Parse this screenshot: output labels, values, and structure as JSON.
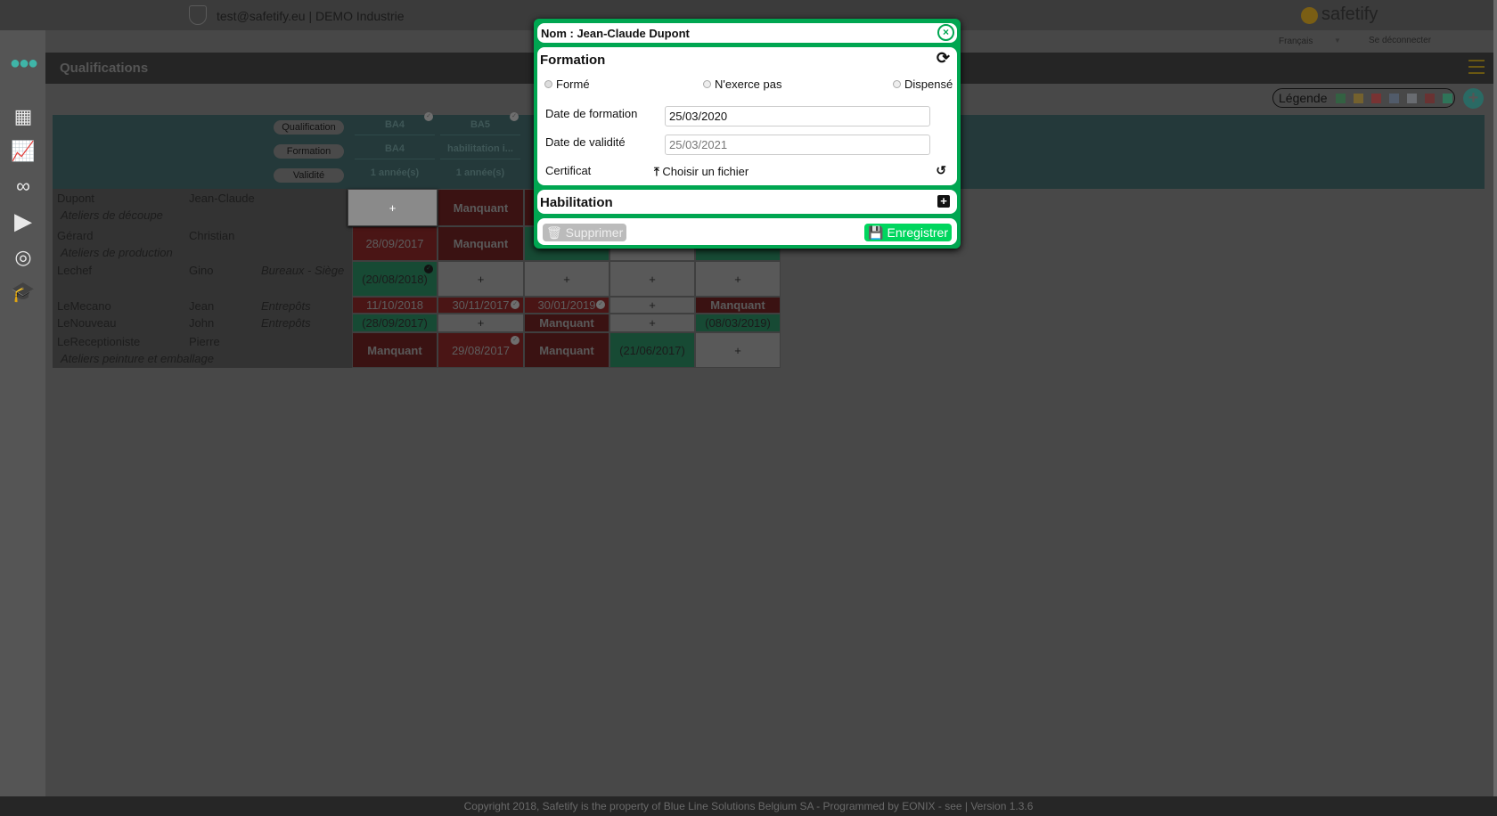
{
  "header": {
    "account": "test@safetify.eu | DEMO Industrie",
    "brand": "safetify",
    "language": "Français",
    "logout": "Se déconnecter"
  },
  "page": {
    "title": "Qualifications"
  },
  "sidebar": {
    "items": [
      "more-icon",
      "buildings-icon",
      "chart-icon",
      "binoculars-icon",
      "play-icon",
      "target-icon",
      "graduation-cap-icon"
    ]
  },
  "legend": {
    "label": "Légende",
    "colors": [
      "#1e7a3c",
      "#a07a14",
      "#a81e1e",
      "#5a6e8c",
      "#8a8f99",
      "#8a1c1c",
      "#16a06a"
    ]
  },
  "table": {
    "header_labels": {
      "qualification": "Qualification",
      "formation": "Formation",
      "validite": "Validité"
    },
    "columns": [
      {
        "qualification": "BA4",
        "formation": "BA4",
        "validite": "1 année(s)",
        "checked": true
      },
      {
        "qualification": "BA5",
        "formation": "habilitation i...",
        "validite": "1 année(s)",
        "checked": true
      }
    ],
    "rows": [
      {
        "last": "Dupont",
        "first": "Jean-Claude",
        "location": "",
        "dept": "Ateliers de découpe",
        "cells": [
          {
            "t": "+",
            "c": "sel"
          },
          {
            "t": "Manquant",
            "c": "dred"
          },
          {
            "t": "",
            "c": "dred"
          },
          {
            "t": "",
            "c": "gry"
          },
          {
            "t": "",
            "c": "grn"
          }
        ]
      },
      {
        "last": "Gérard",
        "first": "Christian",
        "location": "",
        "dept": "Ateliers de production",
        "cells": [
          {
            "t": "28/09/2017",
            "c": "red"
          },
          {
            "t": "Manquant",
            "c": "dred"
          },
          {
            "t": "",
            "c": "grn"
          },
          {
            "t": "",
            "c": "gry"
          },
          {
            "t": "",
            "c": "grn"
          }
        ]
      },
      {
        "last": "Lechef",
        "first": "Gino",
        "location": "Bureaux - Siège",
        "dept": "",
        "cells": [
          {
            "t": "(20/08/2018)",
            "c": "grn",
            "chk": true
          },
          {
            "t": "+",
            "c": "gry"
          },
          {
            "t": "+",
            "c": "gry"
          },
          {
            "t": "+",
            "c": "gry"
          },
          {
            "t": "+",
            "c": "gry"
          }
        ]
      },
      {
        "last": "LeMecano",
        "first": "Jean",
        "location": "Entrepôts",
        "dept": "",
        "cells": [
          {
            "t": "11/10/2018",
            "c": "red"
          },
          {
            "t": "30/11/2017",
            "c": "red",
            "chk": true
          },
          {
            "t": "30/01/2019",
            "c": "red",
            "chk": true
          },
          {
            "t": "+",
            "c": "gry"
          },
          {
            "t": "Manquant",
            "c": "dred"
          }
        ]
      },
      {
        "last": "LeNouveau",
        "first": "John",
        "location": "Entrepôts",
        "dept": "",
        "cells": [
          {
            "t": "(28/09/2017)",
            "c": "grn"
          },
          {
            "t": "+",
            "c": "gry"
          },
          {
            "t": "Manquant",
            "c": "dred"
          },
          {
            "t": "+",
            "c": "gry"
          },
          {
            "t": "(08/03/2019)",
            "c": "grn"
          }
        ]
      },
      {
        "last": "LeReceptioniste",
        "first": "Pierre",
        "location": "",
        "dept": "Ateliers peinture et emballage",
        "cells": [
          {
            "t": "Manquant",
            "c": "dred"
          },
          {
            "t": "29/08/2017",
            "c": "red",
            "chk": true
          },
          {
            "t": "Manquant",
            "c": "dred"
          },
          {
            "t": "(21/06/2017)",
            "c": "grn"
          },
          {
            "t": "+",
            "c": "gry"
          }
        ]
      }
    ]
  },
  "modal": {
    "title": "Nom : Jean-Claude Dupont",
    "formation_title": "Formation",
    "radios": [
      {
        "label": "Formé",
        "checked": true
      },
      {
        "label": "N'exerce pas",
        "checked": false
      },
      {
        "label": "Dispensé",
        "checked": false
      }
    ],
    "date_formation_label": "Date de formation",
    "date_formation": "25/03/2020",
    "date_validite_label": "Date de validité",
    "date_validite": "25/03/2021",
    "certificat_label": "Certificat",
    "file_button": "Choisir un fichier",
    "habilitation_title": "Habilitation",
    "delete_button": "Supprimer",
    "save_button": "Enregistrer"
  },
  "footer": {
    "text": "Copyright 2018, Safetify is the property of Blue Line Solutions Belgium SA - Programmed by EONIX - see | Version 1.3.6"
  }
}
